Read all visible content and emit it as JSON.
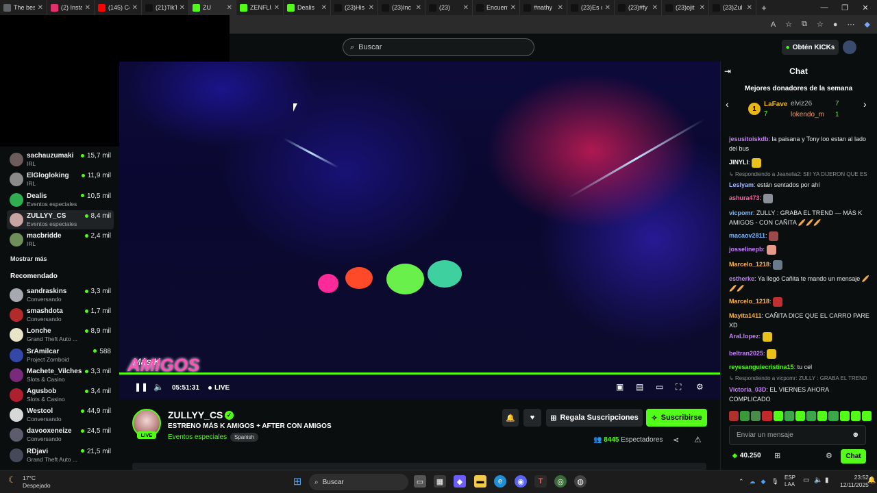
{
  "browser": {
    "tabs": [
      {
        "label": "The bes",
        "icon": "page-icon",
        "color": "#5f6368"
      },
      {
        "label": "(2) Insta",
        "icon": "instagram-icon",
        "color": "#e1306c"
      },
      {
        "label": "(145) Ce",
        "icon": "youtube-icon",
        "color": "#ff0000"
      },
      {
        "label": "(21)TikT",
        "icon": "tiktok-icon",
        "color": "#111111"
      },
      {
        "label": "ZU",
        "icon": "kick-icon",
        "color": "#53fc18"
      },
      {
        "label": "ZENFLU",
        "icon": "kick-icon",
        "color": "#53fc18"
      },
      {
        "label": "Dealis",
        "icon": "kick-icon",
        "color": "#53fc18"
      },
      {
        "label": "(23)His",
        "icon": "tiktok-icon",
        "color": "#111111"
      },
      {
        "label": "(23)Inc",
        "icon": "tiktok-icon",
        "color": "#111111"
      },
      {
        "label": "(23)",
        "icon": "tiktok-icon",
        "color": "#111111"
      },
      {
        "label": "Encuent",
        "icon": "tiktok-icon",
        "color": "#111111"
      },
      {
        "label": "#nathy",
        "icon": "tiktok-icon",
        "color": "#111111"
      },
      {
        "label": "(23)Es c",
        "icon": "tiktok-icon",
        "color": "#111111"
      },
      {
        "label": "(23)#fy",
        "icon": "tiktok-icon",
        "color": "#111111"
      },
      {
        "label": "(23)ojit",
        "icon": "tiktok-icon",
        "color": "#111111"
      },
      {
        "label": "(23)Zul",
        "icon": "tiktok-icon",
        "color": "#111111"
      }
    ],
    "new_tab": "+",
    "toolbar_icons": [
      "read-aloud-icon",
      "favorite-icon",
      "extensions-icon",
      "collections-icon",
      "profile-icon",
      "more-icon",
      "copilot-icon"
    ]
  },
  "header": {
    "search_placeholder": "Buscar",
    "get_kicks": "Obtén KICKs"
  },
  "sidebar": {
    "following": [
      {
        "name": "sachauzumaki",
        "category": "IRL",
        "viewers": "15,7 mil",
        "avatar_color": "#6b5b5b"
      },
      {
        "name": "ElGlogloking",
        "category": "IRL",
        "viewers": "11,9 mil",
        "avatar_color": "#8a8a8a"
      },
      {
        "name": "Dealis",
        "category": "Eventos especiales",
        "viewers": "10,5 mil",
        "avatar_color": "#2fae4f"
      },
      {
        "name": "ZULLYY_CS",
        "category": "Eventos especiales",
        "viewers": "8,4 mil",
        "avatar_color": "#c9a3a1",
        "selected": true
      },
      {
        "name": "macbridde",
        "category": "IRL",
        "viewers": "2,4 mil",
        "avatar_color": "#6f8f5a"
      }
    ],
    "show_more": "Mostrar más",
    "recommended_title": "Recomendado",
    "recommended": [
      {
        "name": "sandraskins",
        "category": "Conversando",
        "viewers": "3,3 mil",
        "avatar_color": "#a8a8b0"
      },
      {
        "name": "smashdota",
        "category": "Conversando",
        "viewers": "1,7 mil",
        "avatar_color": "#b22a2a"
      },
      {
        "name": "Lonche",
        "category": "Grand Theft Auto ...",
        "viewers": "8,9 mil",
        "avatar_color": "#e8e4c8"
      },
      {
        "name": "SrAmilcar",
        "category": "Project Zomboid",
        "viewers": "588",
        "avatar_color": "#3548a8"
      },
      {
        "name": "Machete_Vilches",
        "category": "Slots & Casino",
        "viewers": "3,3 mil",
        "avatar_color": "#7a2a7a"
      },
      {
        "name": "Agusbob",
        "category": "Slots & Casino",
        "viewers": "3,4 mil",
        "avatar_color": "#b01f2f"
      },
      {
        "name": "Westcol",
        "category": "Conversando",
        "viewers": "44,9 mil",
        "avatar_color": "#d8d8d8"
      },
      {
        "name": "davooxeneize",
        "category": "Conversando",
        "viewers": "24,5 mil",
        "avatar_color": "#5c5c6c"
      },
      {
        "name": "RDjavi",
        "category": "Grand Theft Auto ...",
        "viewers": "21,5 mil",
        "avatar_color": "#444a5a"
      }
    ]
  },
  "player": {
    "time": "05:51:31",
    "live": "LIVE",
    "watermark": "AMIGOS",
    "watermark_small": "Más K",
    "progress_fraction": 1.0
  },
  "channel": {
    "name": "ZULLYY_CS",
    "live_badge": "LIVE",
    "title": "ESTRENO MÁS K AMIGOS + AFTER CON AMIGOS",
    "category": "Eventos especiales",
    "language": "Spanish",
    "gift_label": "Regala Suscripciones",
    "subscribe_label": "Suscribirse",
    "viewers_count": "8445",
    "viewers_label": "Espectadores"
  },
  "chat": {
    "title": "Chat",
    "donors_title": "Mejores donadores de la semana",
    "donors": [
      {
        "rank": "1",
        "name": "LaFave",
        "amount": "7"
      },
      {
        "name": "elviz26",
        "amount": "7"
      },
      {
        "name": "lokendo_m",
        "amount": "1"
      }
    ],
    "messages": [
      {
        "user": "jesusitoiskdb",
        "color": "#c77dff",
        "text": "la paisana y Tony loo estan al lado del bus"
      },
      {
        "user": "JINYLI",
        "color": "#ffffff",
        "text": ""
      },
      {
        "reply": "Respondiendo a Jeanelia2: SIII YA DIJERON QUE ES"
      },
      {
        "user": "Leslyam",
        "color": "#a6b8ff",
        "text": "están sentados por ahí"
      },
      {
        "user": "ashura473",
        "color": "#ff5fa2",
        "text": ""
      },
      {
        "user": "vicpomr",
        "color": "#7ab8ff",
        "text": "ZULLY : GRABA EL TREND — MÁS K AMIGOS - CON CAÑITA 🥖🥖🥖"
      },
      {
        "user": "macaov2811",
        "color": "#7ab8ff",
        "text": ""
      },
      {
        "user": "josselinepb",
        "color": "#c77dff",
        "text": ""
      },
      {
        "user": "Marcelo_1218",
        "color": "#ffb347",
        "text": ""
      },
      {
        "user": "estherke",
        "color": "#c77dff",
        "text": "Ya llegó Cañita te mando un mensaje 🥖🥖🥖"
      },
      {
        "user": "Marcelo_1218",
        "color": "#ffb347",
        "text": ""
      },
      {
        "user": "Mayita1411",
        "color": "#ffb347",
        "text": "CAÑITA DICE QUE EL CARRO PARE XD"
      },
      {
        "user": "AraLlopez",
        "color": "#c77dff",
        "text": ""
      },
      {
        "user": "beltran2025",
        "color": "#c77dff",
        "text": ""
      },
      {
        "user": "reyesanguiecristina15",
        "color": "#53fc18",
        "text": "tu cel"
      },
      {
        "reply": "Respondiendo a vicpomr: ZULLY : GRABA EL TREND"
      },
      {
        "user": "Victoria_03D",
        "color": "#c77dff",
        "text": "EL VIERNES AHORA COMPLICADO"
      }
    ],
    "input_placeholder": "Enviar un mensaje",
    "kicks_balance": "40.250",
    "send_label": "Chat"
  },
  "taskbar": {
    "temp": "17°C",
    "weather": "Despejado",
    "search": "Buscar",
    "lang_line1": "ESP",
    "lang_line2": "LAA",
    "time": "23:52",
    "date": "12/11/2025"
  }
}
